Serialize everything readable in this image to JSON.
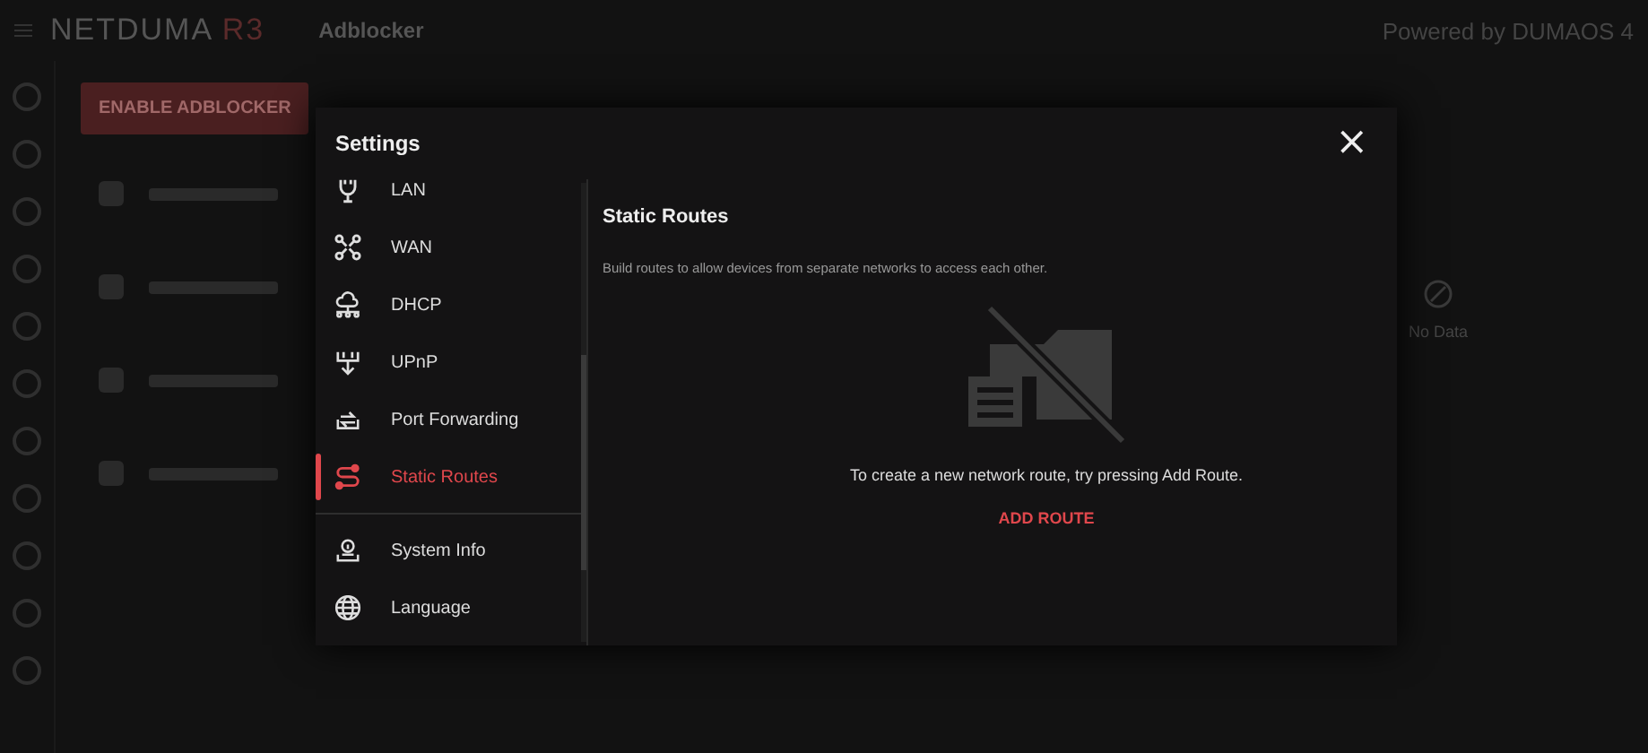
{
  "app": {
    "logo": "NETDUMA",
    "logo_version": "R3",
    "page_title": "Adblocker",
    "powered_by": "Powered by DUMAOS 4"
  },
  "background": {
    "enable_button": "ENABLE ADBLOCKER",
    "empty_label": "No Data"
  },
  "modal": {
    "title": "Settings",
    "close": "×",
    "nav_groups": [
      [
        {
          "label": "LAN",
          "selected": false
        },
        {
          "label": "WAN",
          "selected": false
        },
        {
          "label": "DHCP",
          "selected": false
        },
        {
          "label": "UPnP",
          "selected": false
        },
        {
          "label": "Port Forwarding",
          "selected": false
        },
        {
          "label": "Static Routes",
          "selected": true
        }
      ],
      [
        {
          "label": "System Info",
          "selected": false
        },
        {
          "label": "Language",
          "selected": false
        }
      ]
    ],
    "section_title": "Static Routes",
    "description": "Build routes to allow devices from separate networks to access each other.",
    "empty_message": "To create a new network route, try pressing Add Route.",
    "add_button": "ADD ROUTE"
  }
}
